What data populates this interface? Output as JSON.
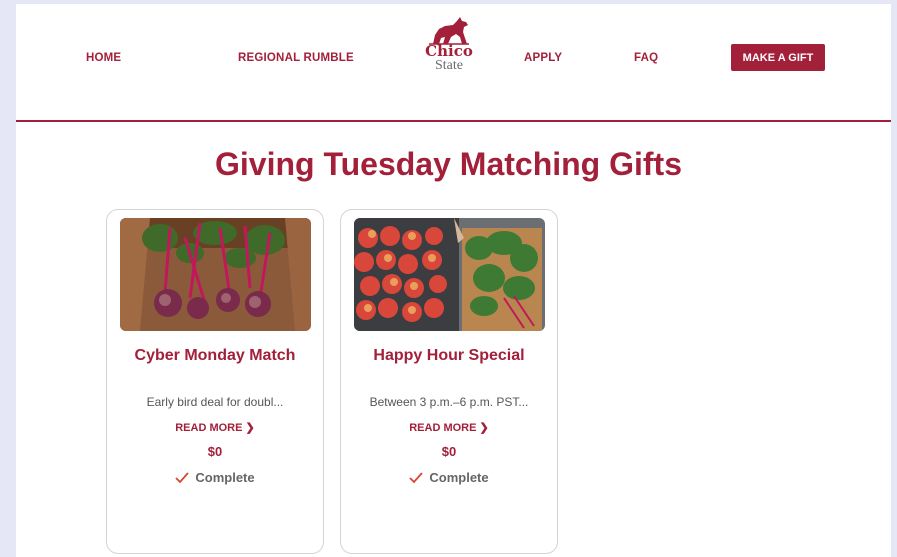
{
  "nav": {
    "home": "HOME",
    "regional_rumble": "REGIONAL RUMBLE",
    "apply": "APPLY",
    "faq": "FAQ",
    "make_a_gift": "MAKE A GIFT"
  },
  "logo": {
    "line1": "Chico",
    "line2": "State",
    "icon": "wildcat-icon"
  },
  "page_title": "Giving Tuesday Matching Gifts",
  "cards": [
    {
      "title": "Cyber Monday Match",
      "description": "Early bird deal for doubl...",
      "read_more": "READ MORE",
      "amount": "$0",
      "status": "Complete",
      "image": "beets-in-box-photo"
    },
    {
      "title": "Happy Hour Special",
      "description": "Between 3 p.m.–6 p.m. PST...",
      "read_more": "READ MORE",
      "amount": "$0",
      "status": "Complete",
      "image": "apples-and-greens-photo"
    }
  ],
  "colors": {
    "brand": "#a3203a",
    "complete_check": "#d9462f",
    "background": "#e6e7f6"
  }
}
